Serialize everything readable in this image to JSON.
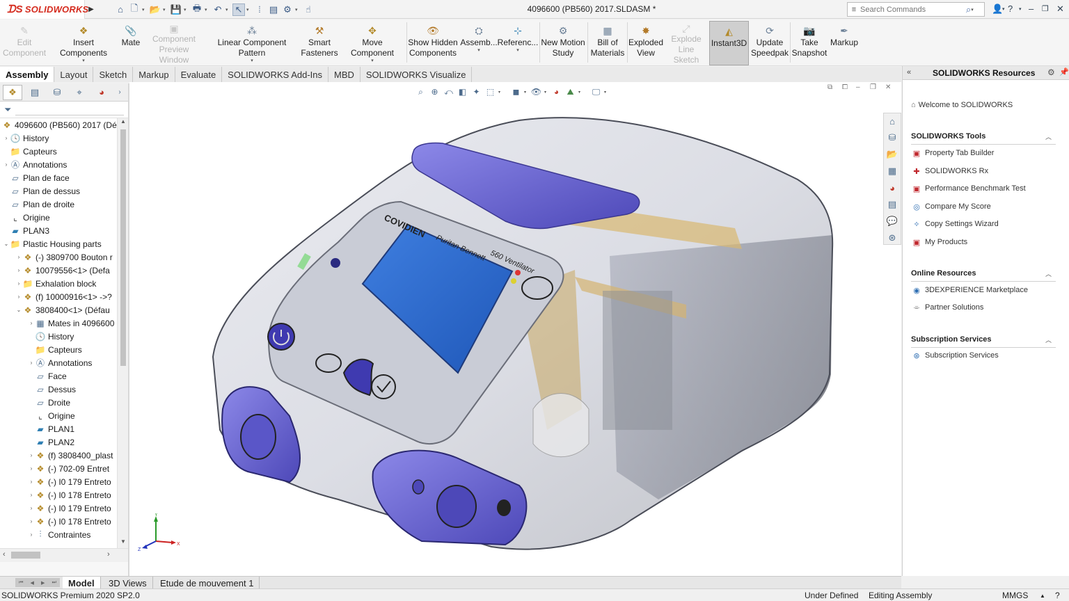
{
  "app": {
    "brand": "SOLIDWORKS",
    "document_title": "4096600 (PB560) 2017.SLDASM *",
    "search_placeholder": "Search Commands"
  },
  "ribbon": [
    {
      "label1": "Edit",
      "label2": "Component",
      "disabled": true
    },
    {
      "label1": "Insert Components",
      "label2": "",
      "disabled": false
    },
    {
      "label1": "Mate",
      "label2": "",
      "disabled": false
    },
    {
      "label1": "Component",
      "label2": "Preview Window",
      "disabled": true
    },
    {
      "label1": "Linear Component Pattern",
      "label2": "",
      "disabled": false
    },
    {
      "label1": "Smart",
      "label2": "Fasteners",
      "disabled": false
    },
    {
      "label1": "Move Component",
      "label2": "",
      "disabled": false
    },
    {
      "label1": "Show Hidden",
      "label2": "Components",
      "disabled": false
    },
    {
      "label1": "Assemb...",
      "label2": "",
      "disabled": false
    },
    {
      "label1": "Referenc...",
      "label2": "",
      "disabled": false
    },
    {
      "label1": "New Motion",
      "label2": "Study",
      "disabled": false
    },
    {
      "label1": "Bill of",
      "label2": "Materials",
      "disabled": false
    },
    {
      "label1": "Exploded",
      "label2": "View",
      "disabled": false
    },
    {
      "label1": "Explode",
      "label2": "Line Sketch",
      "disabled": true
    },
    {
      "label1": "Instant3D",
      "label2": "",
      "disabled": false,
      "active": true
    },
    {
      "label1": "Update",
      "label2": "Speedpak",
      "disabled": false
    },
    {
      "label1": "Take",
      "label2": "Snapshot",
      "disabled": false
    },
    {
      "label1": "Markup",
      "label2": "",
      "disabled": false
    }
  ],
  "command_tabs": [
    "Assembly",
    "Layout",
    "Sketch",
    "Markup",
    "Evaluate",
    "SOLIDWORKS Add-Ins",
    "MBD",
    "SOLIDWORKS Visualize"
  ],
  "tree": {
    "root": "4096600 (PB560) 2017  (Dé",
    "rows": [
      "History",
      "Capteurs",
      "Annotations",
      "Plan de face",
      "Plan de dessus",
      "Plan de droite",
      "Origine",
      "PLAN3",
      "Plastic Housing parts",
      "(-) 3809700 Bouton r",
      "10079556<1> (Defa",
      "Exhalation block",
      "(f) 10000916<1> ->?",
      "3808400<1> (Défau",
      "Mates in 4096600",
      "History",
      "Capteurs",
      "Annotations",
      "Face",
      "Dessus",
      "Droite",
      "Origine",
      "PLAN1",
      "PLAN2",
      "(f) 3808400_plast",
      "(-) 702-09 Entret",
      "(-) I0 179 Entreto",
      "(-) I0 178 Entreto",
      "(-) I0 179 Entreto",
      "(-) I0 178 Entreto",
      "Contraintes"
    ]
  },
  "device": {
    "brand": "COVIDIEN",
    "model_line1": "Puritan Bennett",
    "model_line2": "560 Ventilator"
  },
  "taskpane": {
    "title": "SOLIDWORKS Resources",
    "welcome": "Welcome to SOLIDWORKS",
    "tools_header": "SOLIDWORKS Tools",
    "tools": [
      "Property Tab Builder",
      "SOLIDWORKS Rx",
      "Performance Benchmark Test",
      "Compare My Score",
      "Copy Settings Wizard",
      "My Products"
    ],
    "online_header": "Online Resources",
    "online": [
      "3DEXPERIENCE Marketplace",
      "Partner Solutions"
    ],
    "subs_header": "Subscription Services",
    "subs": [
      "Subscription Services"
    ]
  },
  "bottom_tabs": [
    "Model",
    "3D Views",
    "Etude de mouvement 1"
  ],
  "status": {
    "version": "SOLIDWORKS Premium 2020 SP2.0",
    "state": "Under Defined",
    "mode": "Editing Assembly",
    "units": "MMGS"
  },
  "colors": {
    "brand_red": "#d52b1e",
    "device_purple": "#6f6ad6",
    "screen_blue": "#2f6fd0"
  }
}
